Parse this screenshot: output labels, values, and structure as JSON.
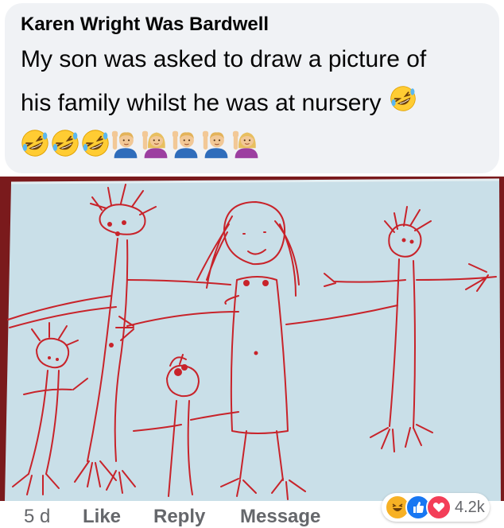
{
  "comment": {
    "author": "Karen Wright Was Bardwell",
    "text_line1": "My son was asked to draw a picture of",
    "text_line2": "his family whilst he was at nursery",
    "inline_emoji": "rolling-on-floor-laughing",
    "emoji_row": [
      "rolling-on-floor-laughing",
      "rolling-on-floor-laughing",
      "rolling-on-floor-laughing",
      "man-raising-hand",
      "woman-raising-hand",
      "man-raising-hand",
      "man-raising-hand",
      "woman-raising-hand"
    ]
  },
  "attachment": {
    "icon": "childs-drawing-photo",
    "colors": {
      "paper": "#c9dfe8",
      "crayon": "#c8232a",
      "frame": "#7a1a1c"
    }
  },
  "actions": {
    "timestamp": "5 d",
    "like": "Like",
    "reply": "Reply",
    "message": "Message"
  },
  "reactions": {
    "icons": [
      "haha",
      "like",
      "love"
    ],
    "count": "4.2k",
    "colors": {
      "haha": "#f7b125",
      "like": "#1877f2",
      "love": "#f33e58"
    }
  }
}
